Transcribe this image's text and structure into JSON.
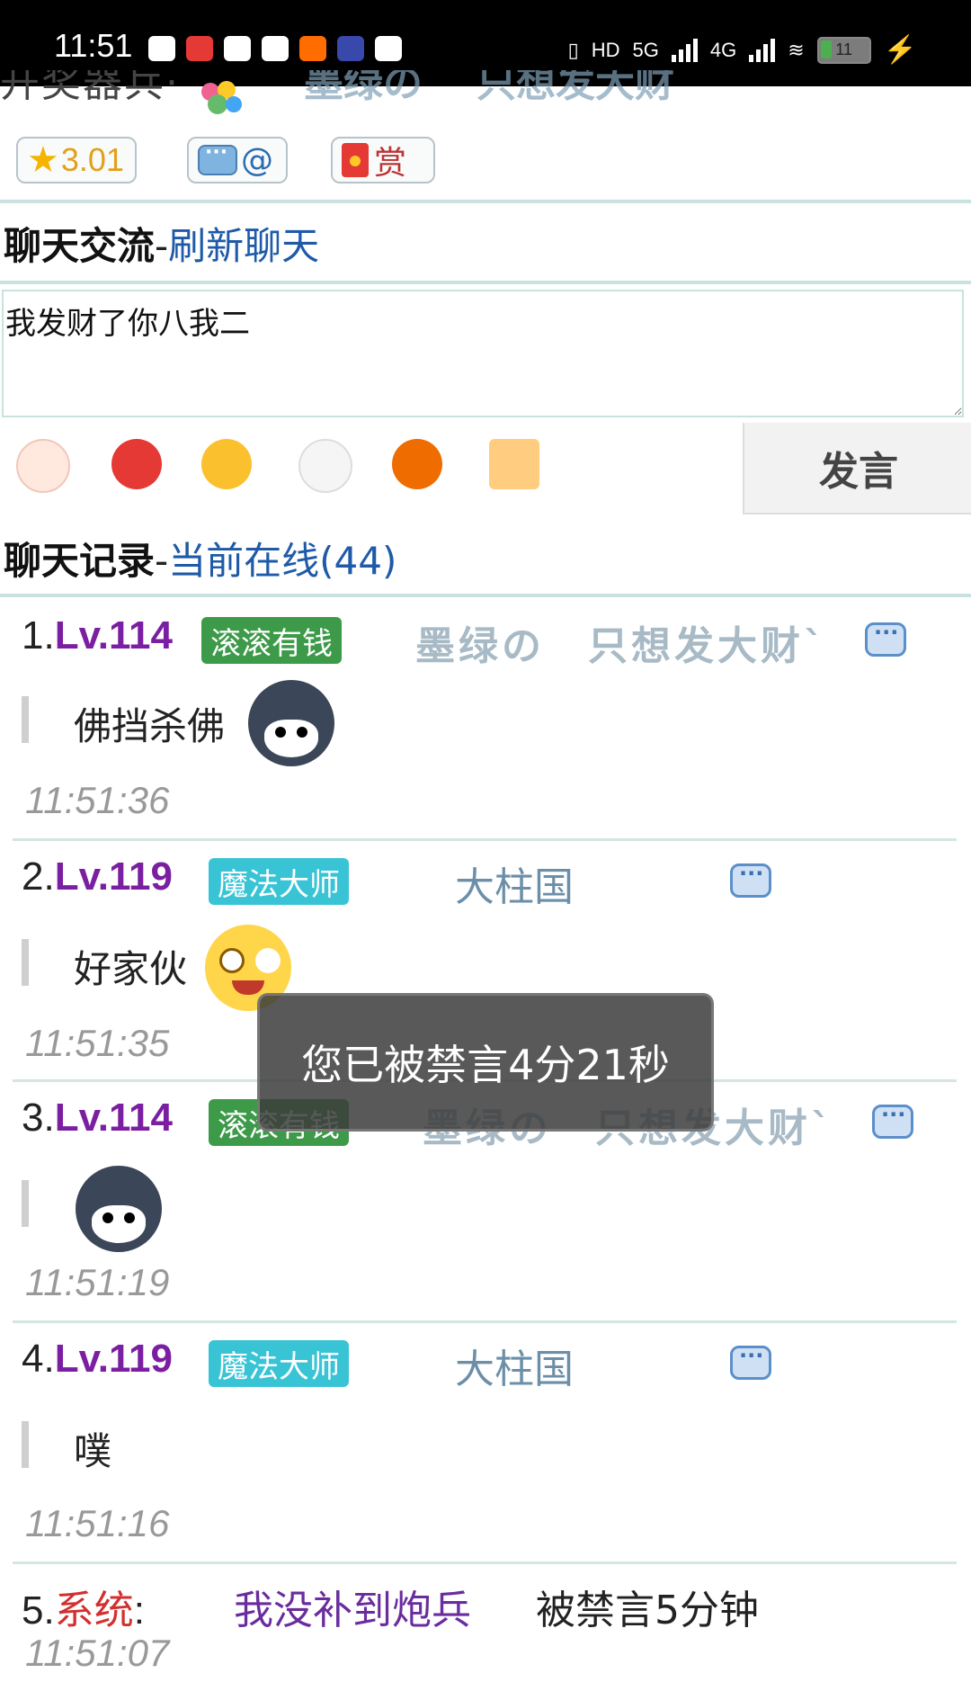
{
  "status_bar": {
    "time": "11:51",
    "network1": "HD",
    "network2": "5G",
    "network3": "4G",
    "battery": "11"
  },
  "header": {
    "title_cut": "开奖器兵·",
    "user_name_a": "墨绿の",
    "user_name_b": "只想发大财"
  },
  "pills": {
    "star_value": "3.01",
    "at_label": "@",
    "reward_label": "赏"
  },
  "chat_section": {
    "title": "聊天交流",
    "dash": "-",
    "refresh_link": "刷新聊天"
  },
  "compose": {
    "value": "我发财了你八我二",
    "send_label": "发言"
  },
  "emoji_icons": [
    "peach-face",
    "fox-face",
    "wink-face",
    "cat-face",
    "lion-dance-face",
    "love-letter"
  ],
  "records_section": {
    "title": "聊天记录",
    "dash": "-",
    "online_link": "当前在线(44)"
  },
  "messages": [
    {
      "index": "1.",
      "level": "Lv.114",
      "badge": "滚滚有钱",
      "badge_color": "#3c9a48",
      "user_a": "墨绿の",
      "user_b": "只想发大财ˋ",
      "text": "佛挡杀佛",
      "sticker": "husky-sticker",
      "time": "11:51:36"
    },
    {
      "index": "2.",
      "level": "Lv.119",
      "badge": "魔法大师",
      "badge_color": "#39c4d6",
      "user_a": "大柱国",
      "user_b": "",
      "text": "好家伙",
      "sticker": "laughing-crying-emoji",
      "time": "11:51:35"
    },
    {
      "index": "3.",
      "level": "Lv.114",
      "badge": "滚滚有钱",
      "badge_color": "#3c9a48",
      "user_a": "墨绿の",
      "user_b": "只想发大财ˋ",
      "text": "",
      "sticker": "husky-sticker",
      "time": "11:51:19"
    },
    {
      "index": "4.",
      "level": "Lv.119",
      "badge": "魔法大师",
      "badge_color": "#39c4d6",
      "user_a": "大柱国",
      "user_b": "",
      "text": "噗",
      "sticker": "",
      "time": "11:51:16"
    }
  ],
  "system_message": {
    "index": "5.",
    "label": "系统",
    "colon": ":",
    "user": "我没补到炮兵",
    "text": "被禁言5分钟",
    "time": "11:51:07"
  },
  "toast": {
    "text": "您已被禁言4分21秒"
  }
}
